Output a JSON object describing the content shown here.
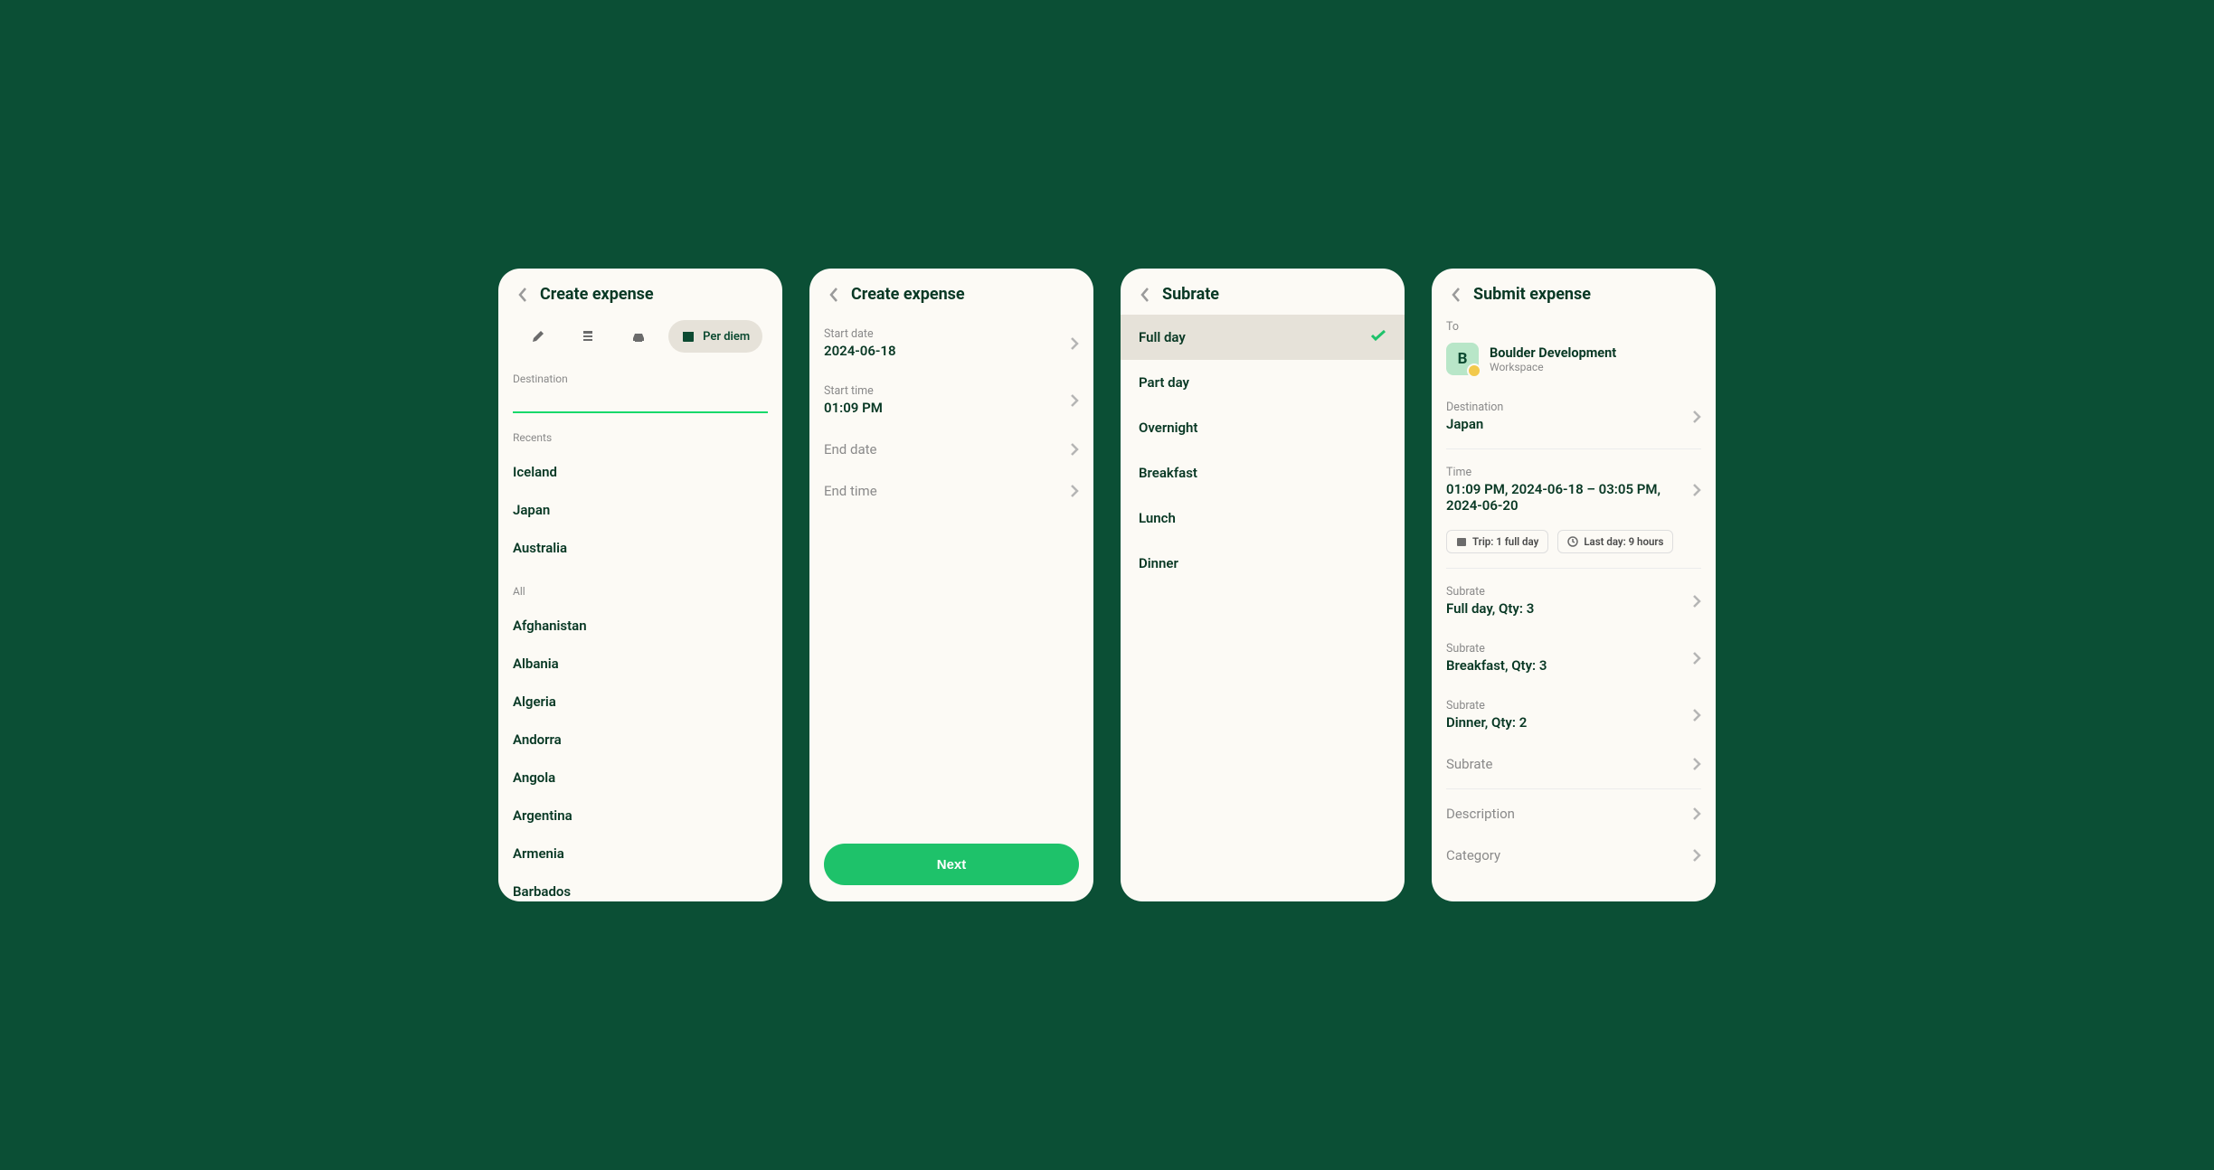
{
  "screen1": {
    "title": "Create expense",
    "tabs": {
      "perdiem": "Per diem"
    },
    "destination_label": "Destination",
    "recents_label": "Recents",
    "recents": [
      "Iceland",
      "Japan",
      "Australia"
    ],
    "all_label": "All",
    "all": [
      "Afghanistan",
      "Albania",
      "Algeria",
      "Andorra",
      "Angola",
      "Argentina",
      "Armenia",
      "Barbados"
    ]
  },
  "screen2": {
    "title": "Create expense",
    "rows": {
      "start_date": {
        "label": "Start date",
        "value": "2024-06-18"
      },
      "start_time": {
        "label": "Start time",
        "value": "01:09 PM"
      },
      "end_date": {
        "label": "End date"
      },
      "end_time": {
        "label": "End time"
      }
    },
    "next_btn": "Next"
  },
  "screen3": {
    "title": "Subrate",
    "items": [
      "Full day",
      "Part day",
      "Overnight",
      "Breakfast",
      "Lunch",
      "Dinner"
    ]
  },
  "screen4": {
    "title": "Submit expense",
    "to_label": "To",
    "workspace": {
      "initial": "B",
      "name": "Boulder Development",
      "sub": "Workspace"
    },
    "destination": {
      "label": "Destination",
      "value": "Japan"
    },
    "time": {
      "label": "Time",
      "value": "01:09 PM, 2024-06-18 – 03:05 PM, 2024-06-20"
    },
    "chips": {
      "trip": "Trip: 1 full day",
      "last": "Last day: 9 hours"
    },
    "subrates": [
      {
        "label": "Subrate",
        "value": "Full day, Qty: 3"
      },
      {
        "label": "Subrate",
        "value": "Breakfast, Qty: 3"
      },
      {
        "label": "Subrate",
        "value": "Dinner, Qty: 2"
      }
    ],
    "subrate_add": "Subrate",
    "description": "Description",
    "category": "Category"
  }
}
